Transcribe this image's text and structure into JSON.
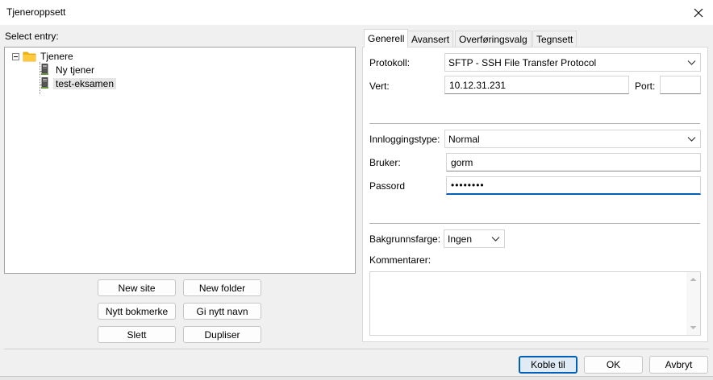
{
  "window": {
    "title": "Tjeneroppsett"
  },
  "left": {
    "select_label": "Select entry:",
    "tree": {
      "root": "Tjenere",
      "children": [
        "Ny tjener",
        "test-eksamen"
      ]
    },
    "buttons": {
      "new_site": "New site",
      "new_folder": "New folder",
      "new_bookmark": "Nytt bokmerke",
      "rename": "Gi nytt navn",
      "delete": "Slett",
      "duplicate": "Dupliser"
    }
  },
  "tabs": [
    "Generell",
    "Avansert",
    "Overføringsvalg",
    "Tegnsett"
  ],
  "general": {
    "protocol_label": "Protokoll:",
    "protocol_value": "SFTP - SSH File Transfer Protocol",
    "host_label": "Vert:",
    "host_value": "10.12.31.231",
    "port_label": "Port:",
    "port_value": "",
    "logon_type_label": "Innloggingstype:",
    "logon_type_value": "Normal",
    "user_label": "Bruker:",
    "user_value": "gorm",
    "password_label": "Passord",
    "password_value": "••••••••",
    "bg_color_label": "Bakgrunnsfarge:",
    "bg_color_value": "Ingen",
    "comments_label": "Kommentarer:"
  },
  "footer": {
    "connect": "Koble til",
    "ok": "OK",
    "cancel": "Avbryt"
  },
  "colors": {
    "accent": "#005fb8",
    "folder": "#f5b700"
  }
}
